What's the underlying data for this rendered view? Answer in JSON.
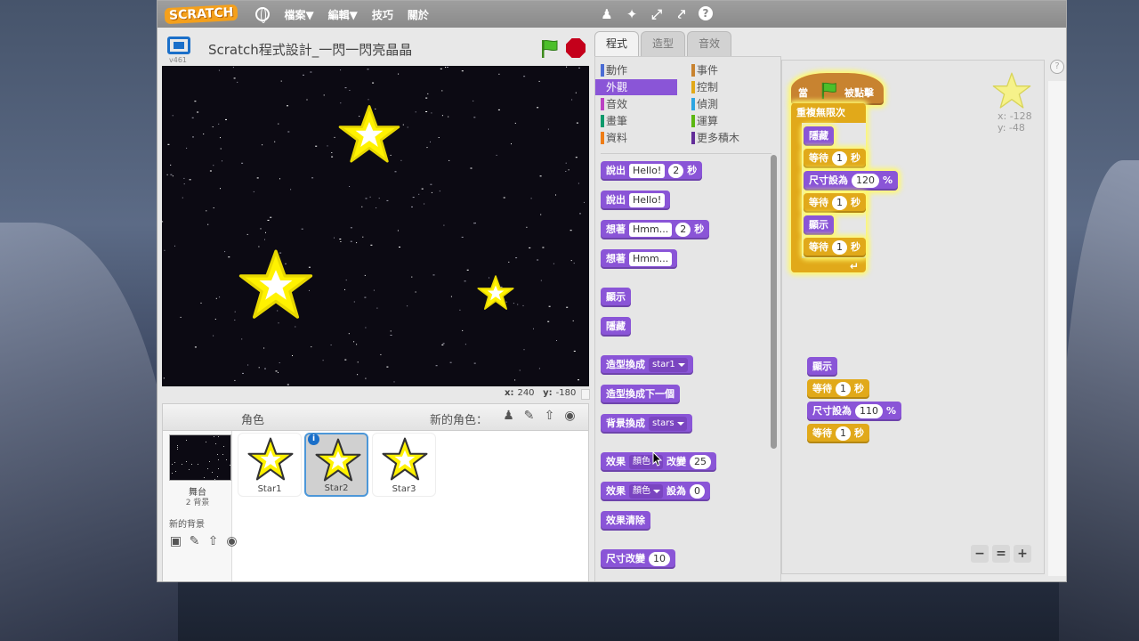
{
  "app": {
    "logo": "SCRATCH",
    "menus": [
      "檔案▼",
      "編輯▼",
      "技巧",
      "關於"
    ],
    "help_icon": "?"
  },
  "stage_header": {
    "version": "v461",
    "project_title": "Scratch程式設計_一閃一閃亮晶晶"
  },
  "stage_coords": {
    "x_label": "x:",
    "x": "240",
    "y_label": "y:",
    "y": "-180"
  },
  "sprite_panel": {
    "sprites_label": "角色",
    "new_sprite_label": "新的角色：",
    "stage_name": "舞台",
    "stage_backdrops": "2 背景",
    "new_backdrop_label": "新的背景",
    "sprites": [
      {
        "name": "Star1",
        "selected": false
      },
      {
        "name": "Star2",
        "selected": true
      },
      {
        "name": "Star3",
        "selected": false
      }
    ],
    "info_icon": "i"
  },
  "tabs": [
    {
      "label": "程式",
      "active": true
    },
    {
      "label": "造型",
      "active": false
    },
    {
      "label": "音效",
      "active": false
    }
  ],
  "categories": [
    {
      "label": "動作",
      "color": "#4a6cd4",
      "selected": false
    },
    {
      "label": "事件",
      "color": "#c88330",
      "selected": false
    },
    {
      "label": "外觀",
      "color": "#8a55d7",
      "selected": true
    },
    {
      "label": "控制",
      "color": "#e1a91a",
      "selected": false
    },
    {
      "label": "音效",
      "color": "#bb42c3",
      "selected": false
    },
    {
      "label": "偵測",
      "color": "#2ca5e2",
      "selected": false
    },
    {
      "label": "畫筆",
      "color": "#0e9a6c",
      "selected": false
    },
    {
      "label": "運算",
      "color": "#5cb712",
      "selected": false
    },
    {
      "label": "資料",
      "color": "#ee7d16",
      "selected": false
    },
    {
      "label": "更多積木",
      "color": "#632d99",
      "selected": false
    }
  ],
  "palette_blocks": {
    "say_for": {
      "a": "說出",
      "field": "Hello!",
      "num": "2",
      "b": "秒"
    },
    "say": {
      "a": "說出",
      "field": "Hello!"
    },
    "think_for": {
      "a": "想著",
      "field": "Hmm...",
      "num": "2",
      "b": "秒"
    },
    "think": {
      "a": "想著",
      "field": "Hmm..."
    },
    "show": "顯示",
    "hide": "隱藏",
    "switch_costume": {
      "a": "造型換成",
      "dd": "star1"
    },
    "next_costume": "造型換成下一個",
    "switch_backdrop": {
      "a": "背景換成",
      "dd": "stars"
    },
    "change_effect": {
      "a": "效果",
      "dd": "顏色",
      "b": "改變",
      "num": "25"
    },
    "set_effect": {
      "a": "效果",
      "dd": "顏色",
      "b": "設為",
      "num": "0"
    },
    "clear_effects": "效果清除",
    "change_size": {
      "a": "尺寸改變",
      "num": "10"
    }
  },
  "script": {
    "hat": {
      "a": "當",
      "b": "被點擊"
    },
    "forever": "重複無限次",
    "hide": "隱藏",
    "wait": "等待",
    "sec": "秒",
    "one": "1",
    "set_size": "尺寸設為",
    "pct": "%",
    "size_120": "120",
    "size_110": "110",
    "show": "顯示"
  },
  "sprite_info": {
    "x": "x: -128",
    "y": "y: -48"
  },
  "zoom": {
    "out": "−",
    "reset": "=",
    "in": "+"
  }
}
